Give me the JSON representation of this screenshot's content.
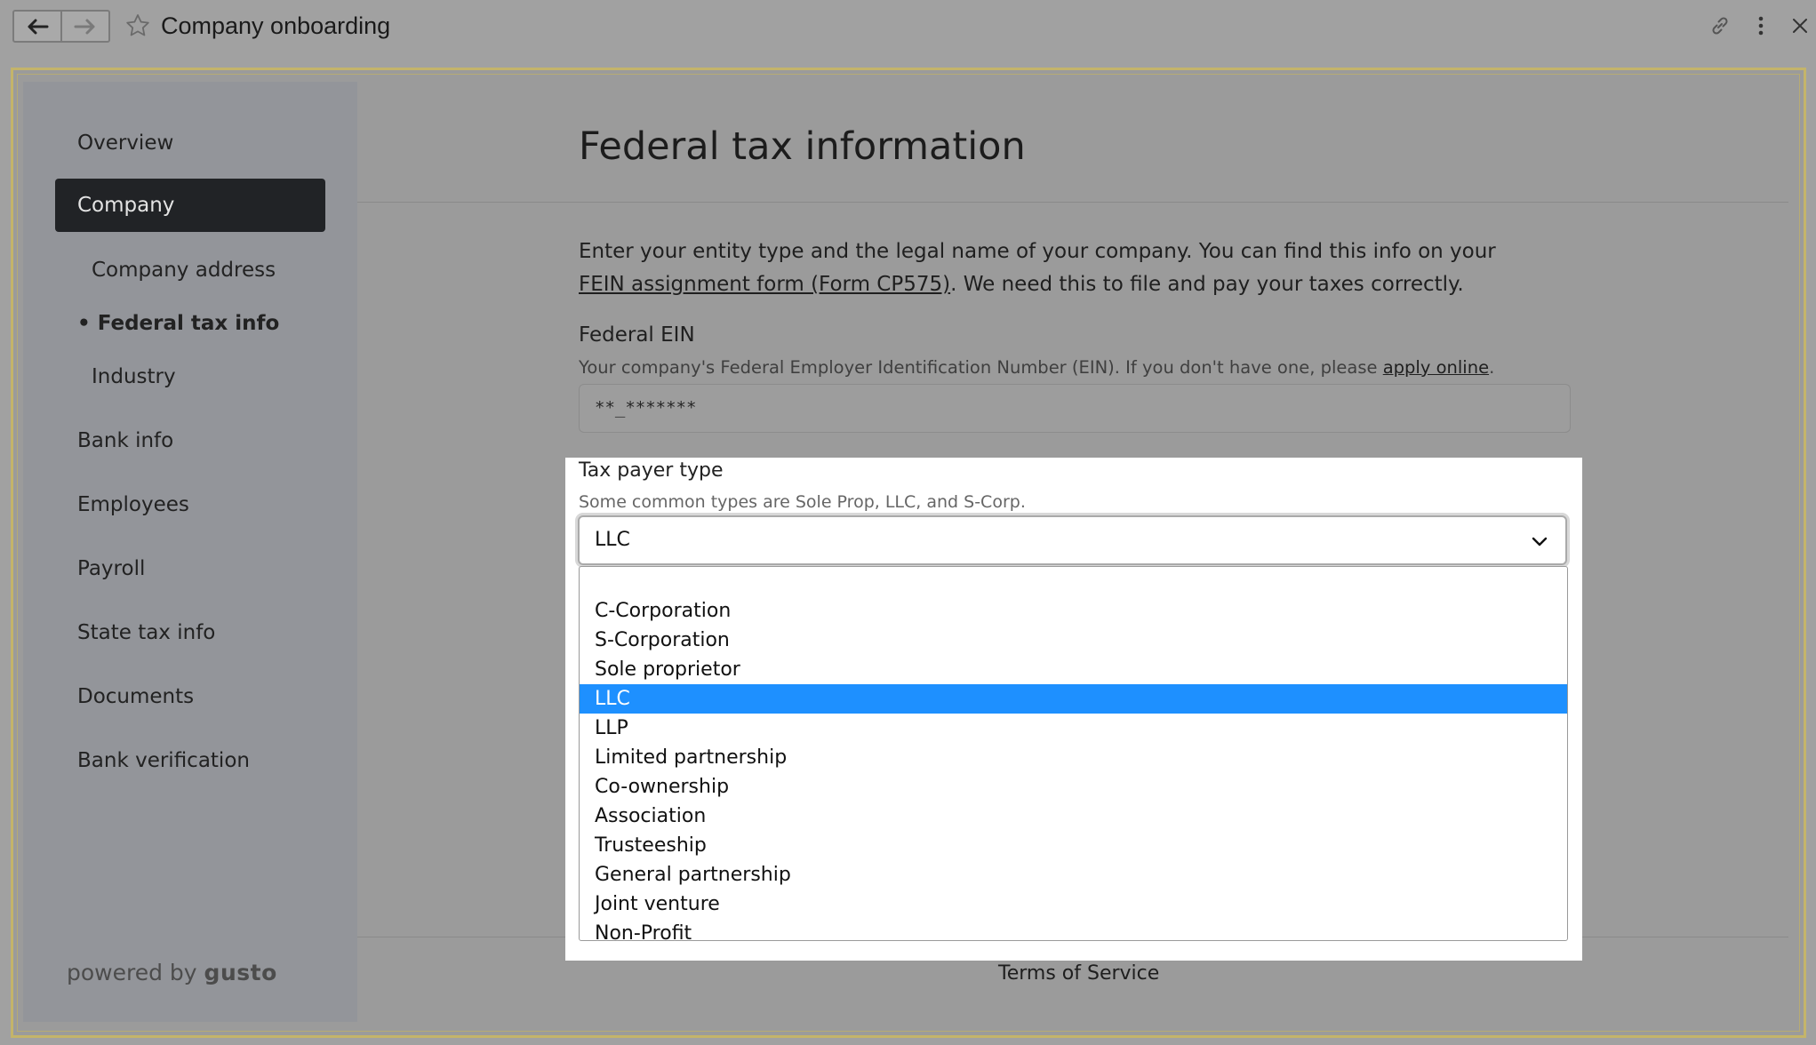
{
  "window": {
    "title": "Company onboarding",
    "icons": [
      "back-arrow-icon",
      "forward-arrow-icon",
      "star-icon",
      "link-icon",
      "more-vertical-icon",
      "close-icon"
    ]
  },
  "sidebar": {
    "overview": "Overview",
    "company": "Company",
    "company_address": "Company address",
    "federal_tax_info": "• Federal tax info",
    "industry": "Industry",
    "bank_info": "Bank info",
    "employees": "Employees",
    "payroll": "Payroll",
    "state_tax_info": "State tax info",
    "documents": "Documents",
    "bank_verification": "Bank verification",
    "powered_prefix": "powered by",
    "powered_brand": "gusto"
  },
  "main": {
    "title": "Federal tax information",
    "intro_part1": "Enter your entity type and the legal name of your company. You can find this info on your ",
    "intro_link": "FEIN assignment form (Form CP575)",
    "intro_part2": ". We need this to file and pay your taxes correctly.",
    "ein_label": "Federal EIN",
    "ein_help_part1": "Your company's Federal Employer Identification Number (EIN). If you don't have one, please ",
    "ein_help_link": "apply online",
    "ein_help_part2": ".",
    "ein_value": "**_*******",
    "terms": "Terms of Service"
  },
  "taxpayer": {
    "label": "Tax payer type",
    "help": "Some common types are Sole Prop, LLC, and S-Corp.",
    "selected": "LLC",
    "options": [
      "",
      "C-Corporation",
      "S-Corporation",
      "Sole proprietor",
      "LLC",
      "LLP",
      "Limited partnership",
      "Co-ownership",
      "Association",
      "Trusteeship",
      "General partnership",
      "Joint venture",
      "Non-Profit"
    ],
    "highlight_color": "#1e90ff"
  }
}
